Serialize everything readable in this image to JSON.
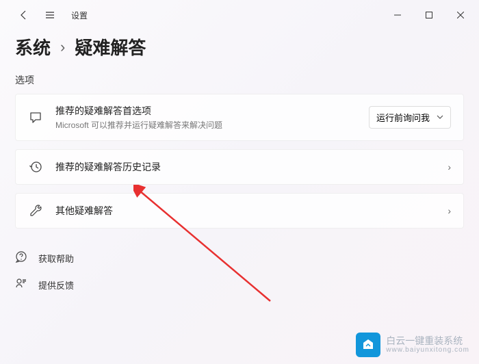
{
  "window": {
    "title": "设置"
  },
  "breadcrumb": {
    "parent": "系统",
    "current": "疑难解答"
  },
  "section_label": "选项",
  "cards": {
    "preferences": {
      "title": "推荐的疑难解答首选项",
      "subtitle": "Microsoft 可以推荐并运行疑难解答来解决问题",
      "dropdown_value": "运行前询问我"
    },
    "history": {
      "title": "推荐的疑难解答历史记录"
    },
    "other": {
      "title": "其他疑难解答"
    }
  },
  "help_links": {
    "get_help": "获取帮助",
    "feedback": "提供反馈"
  },
  "watermark": {
    "text": "白云一键重装系统",
    "url": "www.baiyunxitong.com"
  }
}
